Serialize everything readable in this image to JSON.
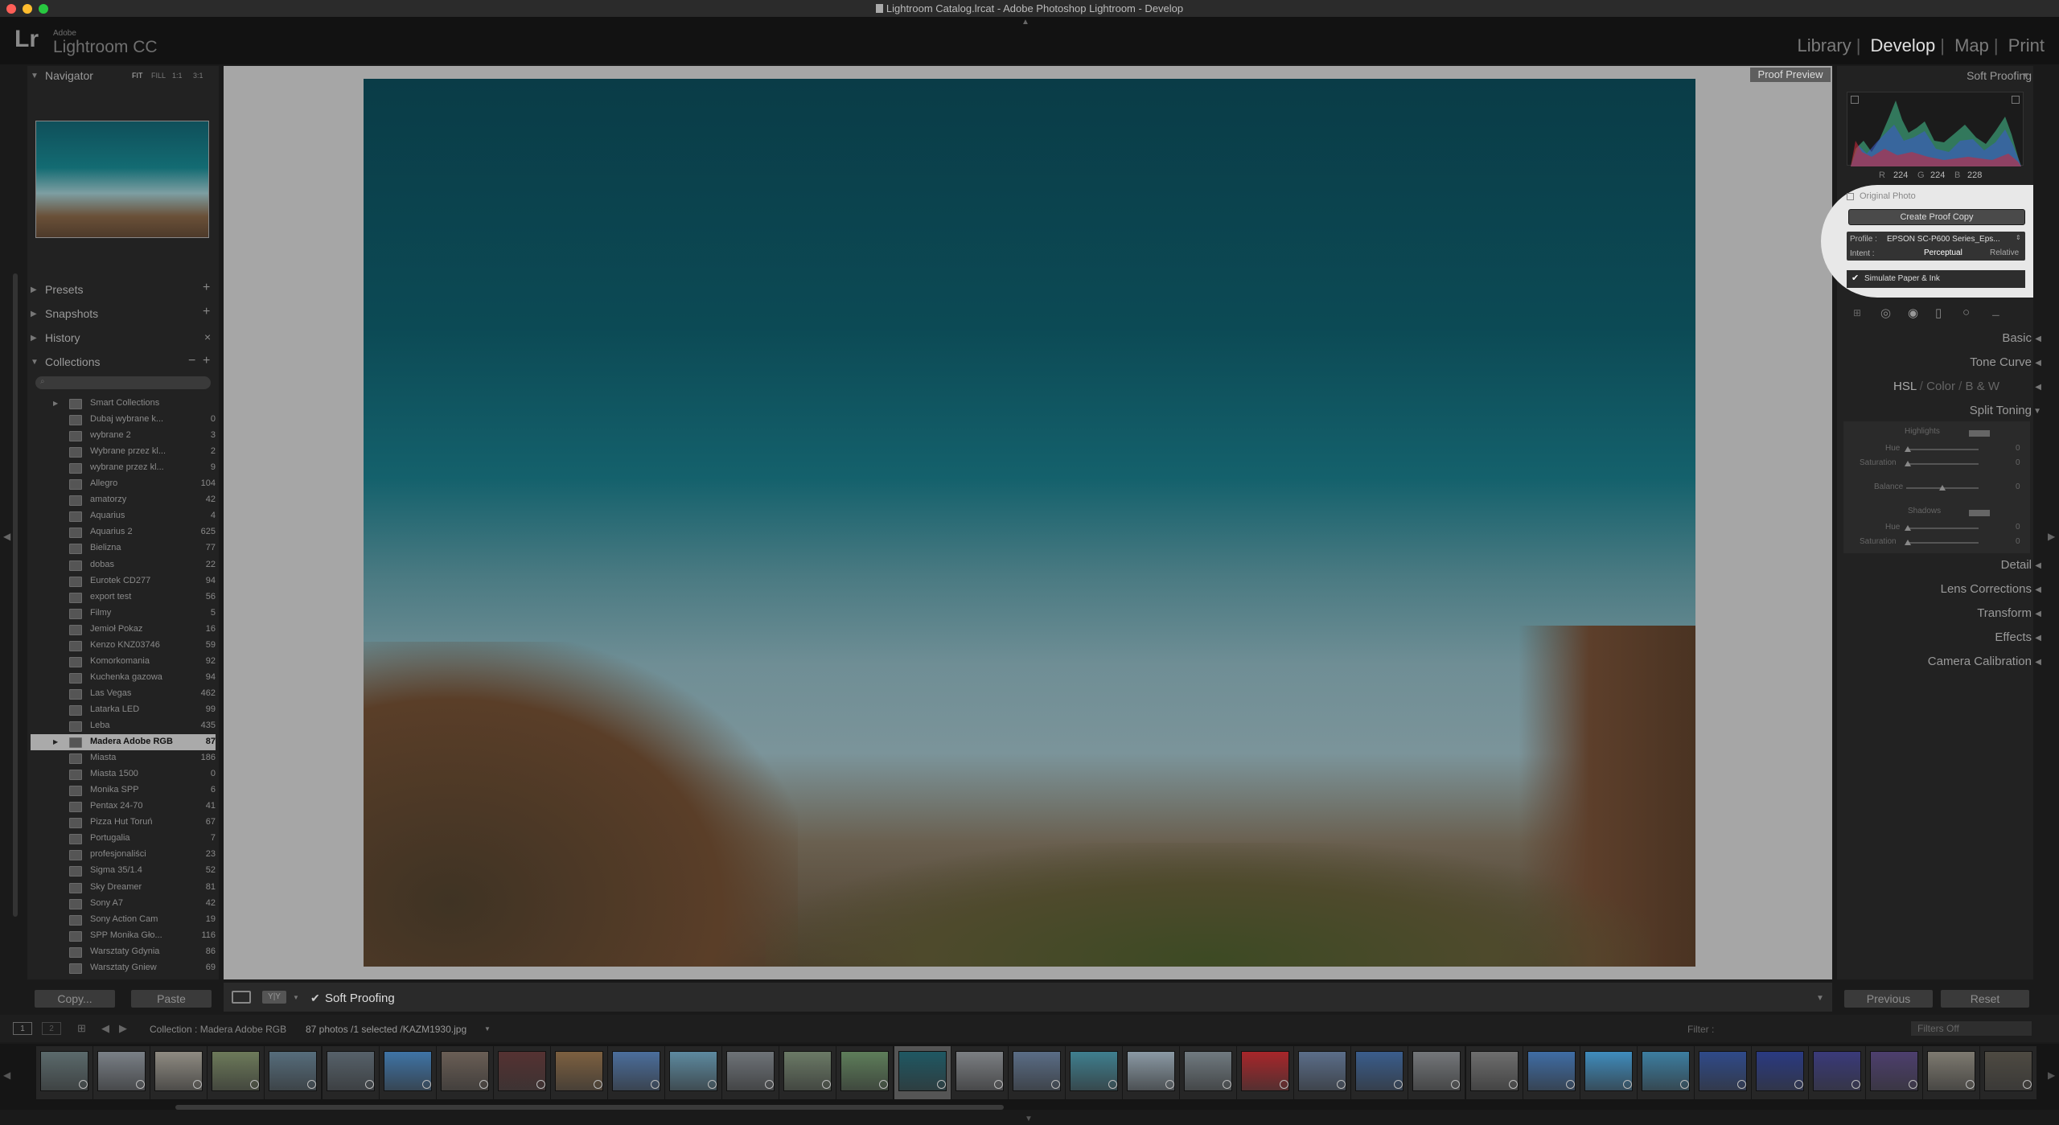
{
  "window": {
    "title": "Lightroom Catalog.lrcat - Adobe Photoshop Lightroom - Develop"
  },
  "header": {
    "logo_mark": "Lr",
    "logo_adobe": "Adobe",
    "logo_product": "Lightroom CC"
  },
  "modules": [
    {
      "label": "Library",
      "active": false
    },
    {
      "label": "Develop",
      "active": true
    },
    {
      "label": "Map",
      "active": false
    },
    {
      "label": "Print",
      "active": false
    }
  ],
  "module_separator": "|",
  "left": {
    "navigator": {
      "title": "Navigator",
      "zoom_opts": [
        "FIT",
        "FILL",
        "1:1",
        "3:1"
      ]
    },
    "presets": {
      "title": "Presets"
    },
    "snapshots": {
      "title": "Snapshots"
    },
    "history": {
      "title": "History"
    },
    "collections": {
      "title": "Collections",
      "items": [
        {
          "name": "Smart Collections",
          "count": ""
        },
        {
          "name": "Dubaj wybrane k...",
          "count": "0"
        },
        {
          "name": "wybrane 2",
          "count": "3"
        },
        {
          "name": "Wybrane przez kl...",
          "count": "2"
        },
        {
          "name": "wybrane przez kl...",
          "count": "9"
        },
        {
          "name": "Allegro",
          "count": "104"
        },
        {
          "name": "amatorzy",
          "count": "42"
        },
        {
          "name": "Aquarius",
          "count": "4"
        },
        {
          "name": "Aquarius 2",
          "count": "625"
        },
        {
          "name": "Bielizna",
          "count": "77"
        },
        {
          "name": "dobas",
          "count": "22"
        },
        {
          "name": "Eurotek CD277",
          "count": "94"
        },
        {
          "name": "export test",
          "count": "56"
        },
        {
          "name": "Filmy",
          "count": "5"
        },
        {
          "name": "Jemioł Pokaz",
          "count": "16"
        },
        {
          "name": "Kenzo KNZ03746",
          "count": "59"
        },
        {
          "name": "Komorkomania",
          "count": "92"
        },
        {
          "name": "Kuchenka gazowa",
          "count": "94"
        },
        {
          "name": "Las Vegas",
          "count": "462"
        },
        {
          "name": "Latarka LED",
          "count": "99"
        },
        {
          "name": "Leba",
          "count": "435"
        },
        {
          "name": "Madera Adobe RGB",
          "count": "87",
          "selected": true
        },
        {
          "name": "Miasta",
          "count": "186"
        },
        {
          "name": "Miasta 1500",
          "count": "0"
        },
        {
          "name": "Monika SPP",
          "count": "6"
        },
        {
          "name": "Pentax 24-70",
          "count": "41"
        },
        {
          "name": "Pizza Hut Toruń",
          "count": "67"
        },
        {
          "name": "Portugalia",
          "count": "7"
        },
        {
          "name": "profesjonaliści",
          "count": "23"
        },
        {
          "name": "Sigma 35/1.4",
          "count": "52"
        },
        {
          "name": "Sky Dreamer",
          "count": "81"
        },
        {
          "name": "Sony A7",
          "count": "42"
        },
        {
          "name": "Sony Action Cam",
          "count": "19"
        },
        {
          "name": "SPP Monika Gło...",
          "count": "116"
        },
        {
          "name": "Warsztaty Gdynia",
          "count": "86"
        },
        {
          "name": "Warsztaty Gniew",
          "count": "69"
        }
      ]
    },
    "copy_label": "Copy...",
    "paste_label": "Paste"
  },
  "view": {
    "proof_preview_label": "Proof Preview"
  },
  "toolbar": {
    "soft_proofing_label": "Soft Proofing",
    "soft_proofing_checked": true
  },
  "right": {
    "soft_proofing_title": "Soft Proofing",
    "histogram": {
      "r_label": "R",
      "r": "224",
      "g_label": "G",
      "g": "224",
      "b_label": "B",
      "b": "228"
    },
    "original_photo_label": "Original Photo",
    "create_proof_label": "Create Proof Copy",
    "profile_label": "Profile :",
    "profile_value": "EPSON SC-P600 Series_Eps...",
    "intent_label": "Intent :",
    "intent_perceptual": "Perceptual",
    "intent_relative": "Relative",
    "simulate_label": "Simulate Paper & Ink",
    "sections": {
      "basic": "Basic",
      "tone_curve": "Tone Curve",
      "hsl": "HSL",
      "color": "Color",
      "bw": "B & W",
      "slash": "/",
      "split_toning": "Split Toning",
      "detail": "Detail",
      "lens": "Lens Corrections",
      "transform": "Transform",
      "effects": "Effects",
      "calibration": "Camera Calibration"
    },
    "split": {
      "highlights": "Highlights",
      "shadows": "Shadows",
      "hue": "Hue",
      "saturation": "Saturation",
      "balance": "Balance",
      "hl_hue": "0",
      "hl_sat": "0",
      "balance_val": "0",
      "sh_hue": "0",
      "sh_sat": "0"
    },
    "previous_label": "Previous",
    "reset_label": "Reset"
  },
  "filmstrip_bar": {
    "collection_label": "Collection : Madera Adobe RGB",
    "photos_info": "87 photos /1 selected /KAZM1930.jpg",
    "filter_label": "Filter :",
    "filters_off": "Filters Off",
    "monitor_1": "1",
    "monitor_2": "2"
  },
  "filmstrip": {
    "thumb_colors": [
      "#5b6a6c",
      "#7a8087",
      "#8f8b82",
      "#6d7a5a",
      "#566d7c",
      "#56616a",
      "#3f74a6",
      "#6a5e55",
      "#553232",
      "#7d6040",
      "#4b6e9c",
      "#5d8aa0",
      "#6e7378",
      "#6b7a66",
      "#5e7e5a",
      "#1f5863",
      "#7c7f83",
      "#5a6d86",
      "#3f7f8f",
      "#8b9aa5",
      "#707a80",
      "#a8262a",
      "#5b6e8a",
      "#3a5d8c",
      "#74777a",
      "#6e6e6e",
      "#3f6da5",
      "#3f8cbd",
      "#3c7ea1",
      "#2f4a8a",
      "#2a3a82",
      "#3a3a7a",
      "#4d3f6e",
      "#7e7a70",
      "#4e4a42"
    ],
    "selected_index": 15
  },
  "colors": {
    "accent": "#e0e0e0",
    "panel": "#222222",
    "background": "#1a1a1a"
  }
}
